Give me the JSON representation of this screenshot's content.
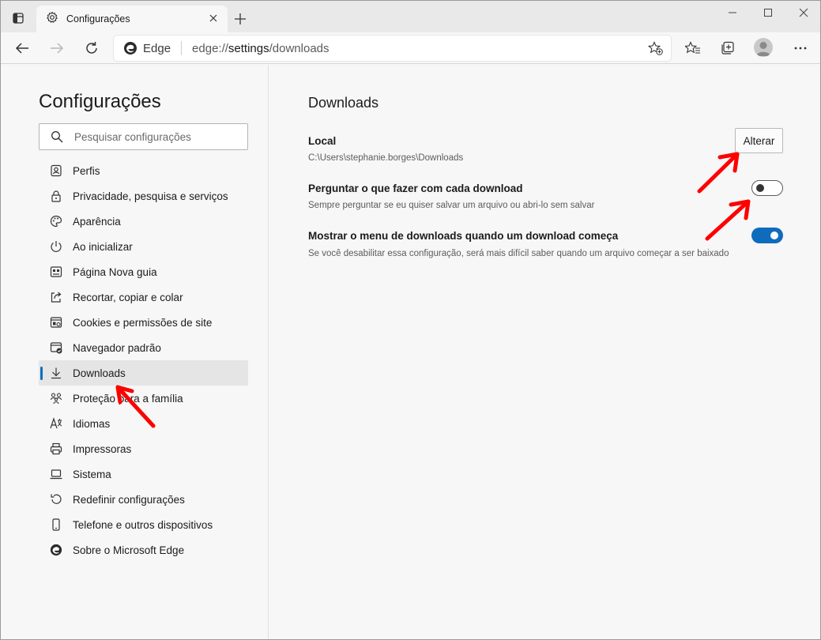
{
  "tab": {
    "title": "Configurações"
  },
  "addressbar": {
    "brand": "Edge",
    "url_prefix": "edge://",
    "url_host": "settings",
    "url_path": "/downloads"
  },
  "sidebar": {
    "title": "Configurações",
    "search_placeholder": "Pesquisar configurações",
    "items": [
      {
        "label": "Perfis",
        "icon": "profile-icon"
      },
      {
        "label": "Privacidade, pesquisa e serviços",
        "icon": "lock-icon"
      },
      {
        "label": "Aparência",
        "icon": "palette-icon"
      },
      {
        "label": "Ao inicializar",
        "icon": "power-icon"
      },
      {
        "label": "Página Nova guia",
        "icon": "new-tab-page-icon"
      },
      {
        "label": "Recortar, copiar e colar",
        "icon": "share-icon"
      },
      {
        "label": "Cookies e permissões de site",
        "icon": "site-permissions-icon"
      },
      {
        "label": "Navegador padrão",
        "icon": "default-browser-icon"
      },
      {
        "label": "Downloads",
        "icon": "download-icon",
        "active": true
      },
      {
        "label": "Proteção para a família",
        "icon": "family-icon"
      },
      {
        "label": "Idiomas",
        "icon": "languages-icon"
      },
      {
        "label": "Impressoras",
        "icon": "printer-icon"
      },
      {
        "label": "Sistema",
        "icon": "laptop-icon"
      },
      {
        "label": "Redefinir configurações",
        "icon": "reset-icon"
      },
      {
        "label": "Telefone e outros dispositivos",
        "icon": "phone-icon"
      },
      {
        "label": "Sobre o Microsoft Edge",
        "icon": "edge-icon"
      }
    ]
  },
  "main": {
    "title": "Downloads",
    "location": {
      "title": "Local",
      "path": "C:\\Users\\stephanie.borges\\Downloads",
      "button_label": "Alterar"
    },
    "ask": {
      "title": "Perguntar o que fazer com cada download",
      "desc": "Sempre perguntar se eu quiser salvar um arquivo ou abri-lo sem salvar",
      "enabled": false
    },
    "menu": {
      "title": "Mostrar o menu de downloads quando um download começa",
      "desc": "Se você desabilitar essa configuração, será mais difícil saber quando um arquivo começar a ser baixado",
      "enabled": true
    }
  },
  "colors": {
    "accent": "#0f6cbd",
    "annotation": "#ff0000"
  }
}
